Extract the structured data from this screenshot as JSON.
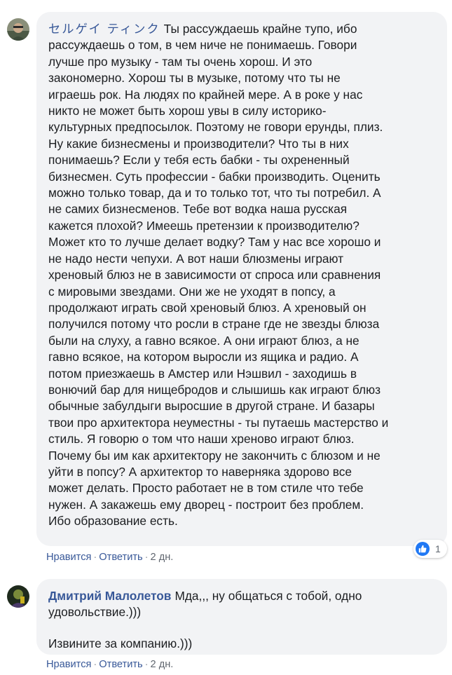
{
  "comments": [
    {
      "author": "セルゲイ ティンク",
      "lines": [
        "Ты рассуждаешь крайне тупо, ибо",
        "рассуждаешь о том, в чем ниче не понимаешь. Говори",
        "лучше про музыку - там ты очень хорош. И это",
        "закономерно. Хорош ты в музыке, потому что ты не",
        "играешь рок. На людях по крайней мере. А в роке у нас",
        "никто не может быть хорош увы в силу историко-",
        "культурных предпосылок. Поэтому не говори ерунды, плиз.",
        "Ну какие бизнесмены и производители? Что ты в них",
        "понимаешь? Если у тебя есть бабки - ты охрененный",
        "бизнесмен. Суть профессии - бабки производить. Оценить",
        "можно только товар, да и то только тот, что ты потребил. А",
        "не самих бизнесменов. Тебе вот водка наша русская",
        "кажется плохой? Имеешь претензии к производителю?",
        "Может кто то лучше делает водку? Там у нас все хорошо и",
        "не надо нести чепухи. А вот наши блюзмены играют",
        "хреновый блюз не в зависимости от спроса или сравнения",
        "с мировыми звездами. Они же не уходят в попсу, а",
        "продолжают играть свой хреновый блюз. А хреновый он",
        "получился потому что росли в стране где не звезды блюза",
        "были на слуху, а гавно всякое. А они играют блюз, а не",
        "гавно всякое, на котором выросли из ящика и радио. А",
        "потом приезжаешь в Амстер или Нэшвил - заходишь в",
        "вонючий бар для нищебродов и слышишь как играют блюз",
        "обычные забулдыги выросшие в другой стране. И базары",
        "твои про архитектора неуместны - ты путаешь мастерство и",
        "стиль. Я говорю о том что наши хреново играют блюз.",
        "Почему бы им как архитектору не закончить с блюзом и не",
        "уйти в попсу? А архитектор то наверняка здорово все",
        "может делать. Просто работает не в том стиле что тебе",
        "нужен. А закажешь ему дворец - построит без проблем.",
        "Ибо образование есть."
      ],
      "reaction_count": "1",
      "actions": {
        "like": "Нравится",
        "reply": "Ответить",
        "time": "2 дн.",
        "sep": "·"
      }
    },
    {
      "author": "Дмитрий Малолетов",
      "lines": [
        "Мда,,, ну общаться с тобой, одно",
        "удовольствие.)))"
      ],
      "lines2": [
        "Извините за компанию.)))"
      ],
      "actions": {
        "like": "Нравится",
        "reply": "Ответить",
        "time": "2 дн.",
        "sep": "·"
      }
    }
  ],
  "colors": {
    "bubble": "#f2f3f5",
    "author": "#385898",
    "link": "#385898",
    "like_blue": "#2078f4"
  }
}
